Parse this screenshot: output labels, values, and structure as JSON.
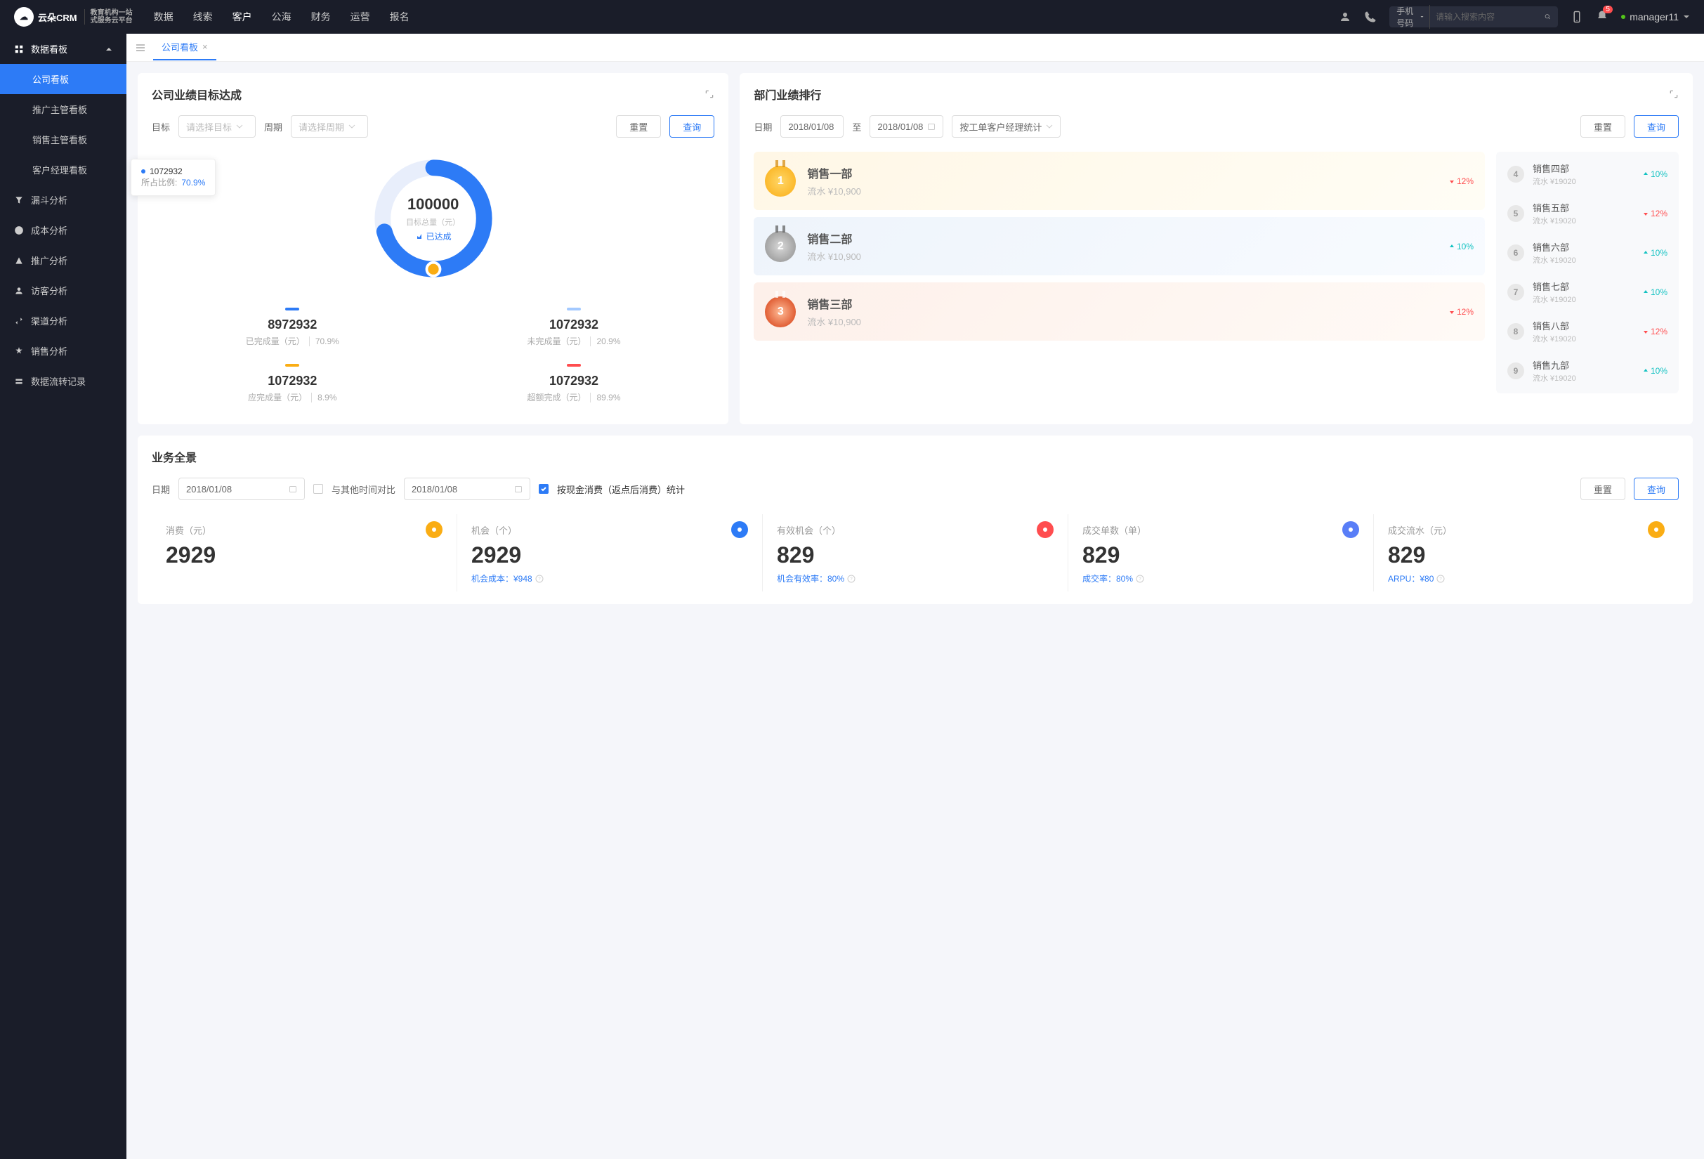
{
  "logo": {
    "main": "云朵CRM",
    "sub1": "教育机构一站",
    "sub2": "式服务云平台"
  },
  "topnav": [
    "数据",
    "线索",
    "客户",
    "公海",
    "财务",
    "运营",
    "报名"
  ],
  "topnav_active": 2,
  "search": {
    "type": "手机号码",
    "placeholder": "请输入搜索内容"
  },
  "badge": "5",
  "user": "manager11",
  "sidebar": {
    "group": "数据看板",
    "subs": [
      "公司看板",
      "推广主管看板",
      "销售主管看板",
      "客户经理看板"
    ],
    "items": [
      "漏斗分析",
      "成本分析",
      "推广分析",
      "访客分析",
      "渠道分析",
      "销售分析",
      "数据流转记录"
    ]
  },
  "tab": "公司看板",
  "card1": {
    "title": "公司业绩目标达成",
    "target_label": "目标",
    "target_ph": "请选择目标",
    "period_label": "周期",
    "period_ph": "请选择周期",
    "reset": "重置",
    "query": "查询",
    "center_num": "100000",
    "center_sub": "目标总量（元）",
    "center_tag": "已达成",
    "tip_val": "1072932",
    "tip_pct_label": "所占比例:",
    "tip_pct": "70.9%",
    "stats": [
      {
        "color": "#2d7bf6",
        "num": "8972932",
        "label": "已完成量（元）",
        "pct": "70.9%"
      },
      {
        "color": "#a3c9ff",
        "num": "1072932",
        "label": "未完成量（元）",
        "pct": "20.9%"
      },
      {
        "color": "#faad14",
        "num": "1072932",
        "label": "应完成量（元）",
        "pct": "8.9%"
      },
      {
        "color": "#ff4d4f",
        "num": "1072932",
        "label": "超额完成（元）",
        "pct": "89.9%"
      }
    ]
  },
  "card2": {
    "title": "部门业绩排行",
    "date_label": "日期",
    "date1": "2018/01/08",
    "to": "至",
    "date2": "2018/01/08",
    "stat_by": "按工单客户经理统计",
    "reset": "重置",
    "query": "查询",
    "top3": [
      {
        "name": "销售一部",
        "sub": "流水 ¥10,900",
        "trend": "12%",
        "dir": "down"
      },
      {
        "name": "销售二部",
        "sub": "流水 ¥10,900",
        "trend": "10%",
        "dir": "up"
      },
      {
        "name": "销售三部",
        "sub": "流水 ¥10,900",
        "trend": "12%",
        "dir": "down"
      }
    ],
    "rest": [
      {
        "idx": "4",
        "name": "销售四部",
        "sub": "流水 ¥19020",
        "trend": "10%",
        "dir": "up"
      },
      {
        "idx": "5",
        "name": "销售五部",
        "sub": "流水 ¥19020",
        "trend": "12%",
        "dir": "down"
      },
      {
        "idx": "6",
        "name": "销售六部",
        "sub": "流水 ¥19020",
        "trend": "10%",
        "dir": "up"
      },
      {
        "idx": "7",
        "name": "销售七部",
        "sub": "流水 ¥19020",
        "trend": "10%",
        "dir": "up"
      },
      {
        "idx": "8",
        "name": "销售八部",
        "sub": "流水 ¥19020",
        "trend": "12%",
        "dir": "down"
      },
      {
        "idx": "9",
        "name": "销售九部",
        "sub": "流水 ¥19020",
        "trend": "10%",
        "dir": "up"
      }
    ]
  },
  "card3": {
    "title": "业务全景",
    "date_label": "日期",
    "date1": "2018/01/08",
    "compare": "与其他时间对比",
    "date2": "2018/01/08",
    "cash_check": "按现金消费（返点后消费）统计",
    "reset": "重置",
    "query": "查询",
    "metrics": [
      {
        "label": "消费（元）",
        "num": "2929",
        "sub": "",
        "icon": "#faad14"
      },
      {
        "label": "机会（个）",
        "num": "2929",
        "sub": "机会成本：¥948",
        "icon": "#2d7bf6"
      },
      {
        "label": "有效机会（个）",
        "num": "829",
        "sub": "机会有效率：80%",
        "icon": "#ff4d4f"
      },
      {
        "label": "成交单数（单）",
        "num": "829",
        "sub": "成交率：80%",
        "icon": "#597ef7"
      },
      {
        "label": "成交流水（元）",
        "num": "829",
        "sub": "ARPU：¥80",
        "icon": "#faad14"
      }
    ]
  },
  "chart_data": {
    "type": "pie",
    "title": "目标总量（元）",
    "total": 100000,
    "series": [
      {
        "name": "已完成",
        "value": 1072932,
        "pct": 70.9,
        "color": "#2d7bf6"
      }
    ]
  }
}
